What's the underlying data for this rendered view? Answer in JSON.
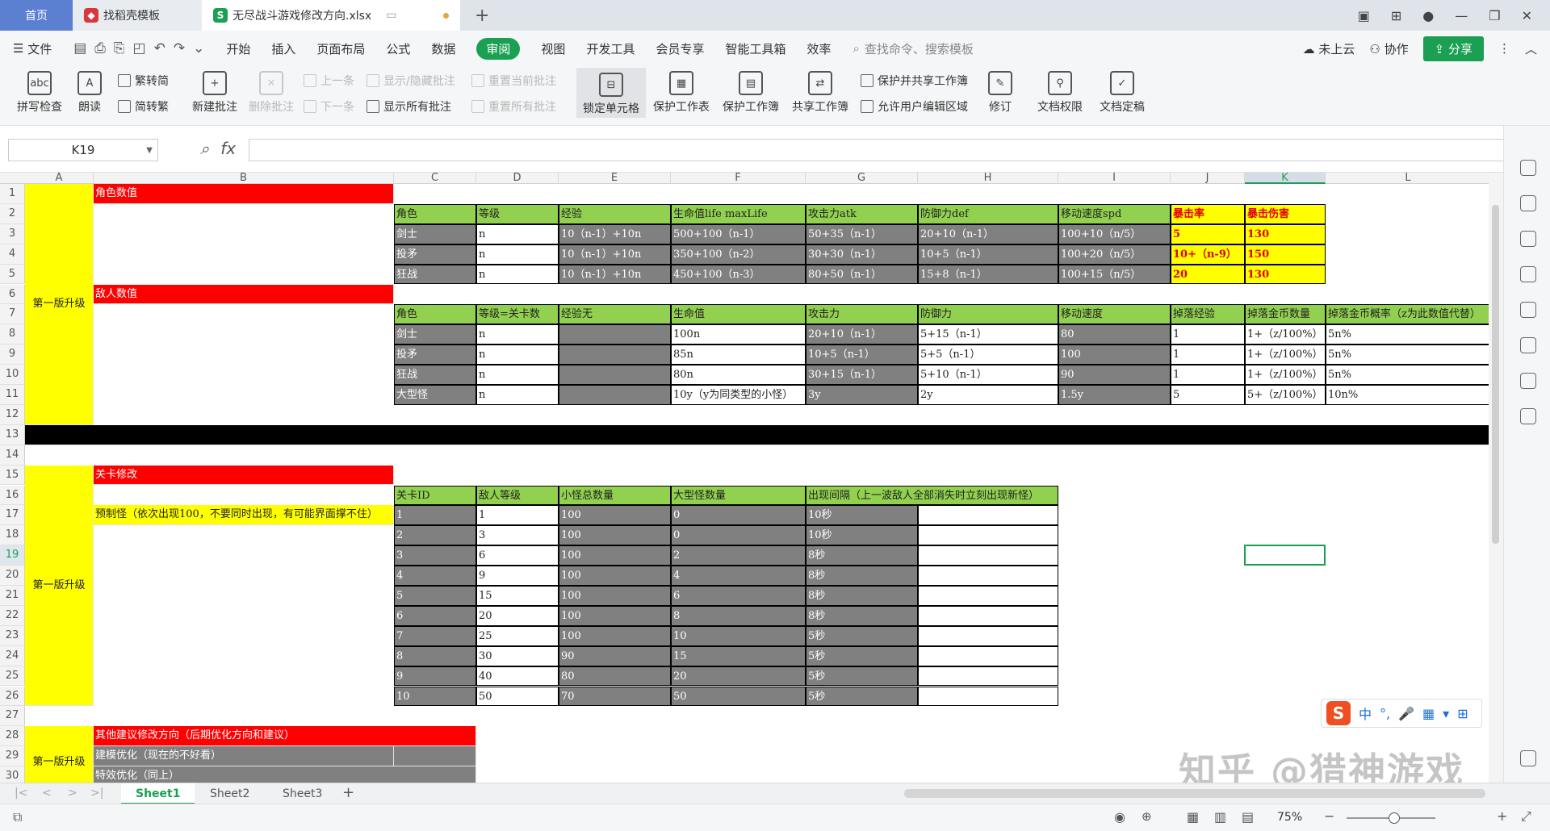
{
  "tabs": [
    {
      "label": "首页"
    },
    {
      "label": "找稻壳模板"
    },
    {
      "label": "无尽战斗游戏修改方向.xlsx"
    }
  ],
  "menu": {
    "file": "文件",
    "items": [
      "开始",
      "插入",
      "页面布局",
      "公式",
      "数据",
      "审阅",
      "视图",
      "开发工具",
      "会员专享",
      "智能工具箱",
      "效率"
    ],
    "active": "审阅",
    "search": "查找命令、搜索模板",
    "cloud": "未上云",
    "collab": "协作",
    "share": "分享"
  },
  "ribbon": {
    "spell": "拼写检查",
    "read": "朗读",
    "trad": "繁转简",
    "simp": "简转繁",
    "new_comment": "新建批注",
    "del_comment": "删除批注",
    "prev": "上一条",
    "next": "下一条",
    "toggle": "显示/隐藏批注",
    "show_all": "显示所有批注",
    "reset_cur": "重置当前批注",
    "reset_all": "重置所有批注",
    "lock_cell": "锁定单元格",
    "protect_sheet": "保护工作表",
    "protect_book": "保护工作簿",
    "share_book": "共享工作簿",
    "protect_share": "保护并共享工作簿",
    "allow_edit": "允许用户编辑区域",
    "revise": "修订",
    "doc_perm": "文档权限",
    "doc_final": "文档定稿"
  },
  "namebox": "K19",
  "fx": "fx",
  "columns": [
    "A",
    "B",
    "C",
    "D",
    "E",
    "F",
    "G",
    "H",
    "I",
    "J",
    "K",
    "L"
  ],
  "selected": {
    "col": "K",
    "row": "19"
  },
  "rows": [
    "1",
    "2",
    "3",
    "4",
    "5",
    "6",
    "7",
    "8",
    "9",
    "10",
    "11",
    "12",
    "13",
    "14",
    "15",
    "16",
    "17",
    "18",
    "19",
    "20",
    "21",
    "22",
    "23",
    "24",
    "25",
    "26",
    "27",
    "28",
    "29",
    "30"
  ],
  "cells": {
    "a_v1": "第一版升级",
    "a_v2": "第一版升级",
    "a_v3": "第一版升级",
    "b1": "角色数值",
    "b6": "敌人数值",
    "b15": "关卡修改",
    "b17": "预制怪（依次出现100，不要同时出现，有可能界面撑不住）",
    "b28": "其他建议修改方向（后期优化方向和建议）",
    "b29": "建模优化（现在的不好看）",
    "b30": "特效优化（同上）",
    "hdr2": [
      "角色",
      "等级",
      "经验",
      "生命值life  maxLife",
      "攻击力atk",
      "防御力def",
      "移动速度spd",
      "暴击率",
      "暴击伤害"
    ],
    "r3": [
      "剑士",
      "n",
      "10（n-1）+10n",
      "500+100（n-1）",
      "50+35（n-1）",
      "20+10（n-1）",
      "100+10（n/5）",
      "5",
      "130"
    ],
    "r4": [
      "投矛",
      "n",
      "10（n-1）+10n",
      "350+100（n-2）",
      "30+30（n-1）",
      "10+5（n-1）",
      "100+20（n/5）",
      "10+（n-9）",
      "150"
    ],
    "r5": [
      "狂战",
      "n",
      "10（n-1）+10n",
      "450+100（n-3）",
      "80+50（n-1）",
      "15+8（n-1）",
      "100+15（n/5）",
      "20",
      "130"
    ],
    "hdr7": [
      "角色",
      "等级=关卡数",
      "经验无",
      "生命值",
      "攻击力",
      "防御力",
      "移动速度",
      "掉落经验",
      "掉落金币数量",
      "掉落金币概率（z为此数值代替）"
    ],
    "r8": [
      "剑士",
      "n",
      "",
      "100n",
      "20+10（n-1）",
      "5+15（n-1）",
      "80",
      "1",
      "1+（z/100%）",
      "5n%"
    ],
    "r9": [
      "投矛",
      "n",
      "",
      "85n",
      "10+5（n-1）",
      "5+5（n-1）",
      "100",
      "1",
      "1+（z/100%）",
      "5n%"
    ],
    "r10": [
      "狂战",
      "n",
      "",
      "80n",
      "30+15（n-1）",
      "5+10（n-1）",
      "90",
      "1",
      "1+（z/100%）",
      "5n%"
    ],
    "r11": [
      "大型怪",
      "n",
      "",
      "10y（y为同类型的小怪）",
      "3y",
      "2y",
      "1.5y",
      "5",
      "5+（z/100%）",
      "10n%"
    ],
    "hdr16": [
      "关卡ID",
      "敌人等级",
      "小怪总数量",
      "大型怪数量",
      "出现间隔（上一波敌人全部消失时立刻出现新怪）"
    ],
    "levels": [
      [
        "1",
        "1",
        "100",
        "0",
        "10秒"
      ],
      [
        "2",
        "3",
        "100",
        "0",
        "10秒"
      ],
      [
        "3",
        "6",
        "100",
        "2",
        "8秒"
      ],
      [
        "4",
        "9",
        "100",
        "4",
        "8秒"
      ],
      [
        "5",
        "15",
        "100",
        "6",
        "8秒"
      ],
      [
        "6",
        "20",
        "100",
        "8",
        "8秒"
      ],
      [
        "7",
        "25",
        "100",
        "10",
        "5秒"
      ],
      [
        "8",
        "30",
        "90",
        "15",
        "5秒"
      ],
      [
        "9",
        "40",
        "80",
        "20",
        "5秒"
      ],
      [
        "10",
        "50",
        "70",
        "50",
        "5秒"
      ]
    ]
  },
  "sheets": [
    "Sheet1",
    "Sheet2",
    "Sheet3"
  ],
  "active_sheet": "Sheet1",
  "zoom": "75%",
  "ime": {
    "label": "中"
  },
  "watermark": "知乎 @猎神游戏",
  "colors": {
    "accent": "#1a9f53",
    "header_green": "#92d050",
    "title_red": "#ff0000",
    "cell_gray": "#808080",
    "version_yellow": "#ffff00"
  }
}
